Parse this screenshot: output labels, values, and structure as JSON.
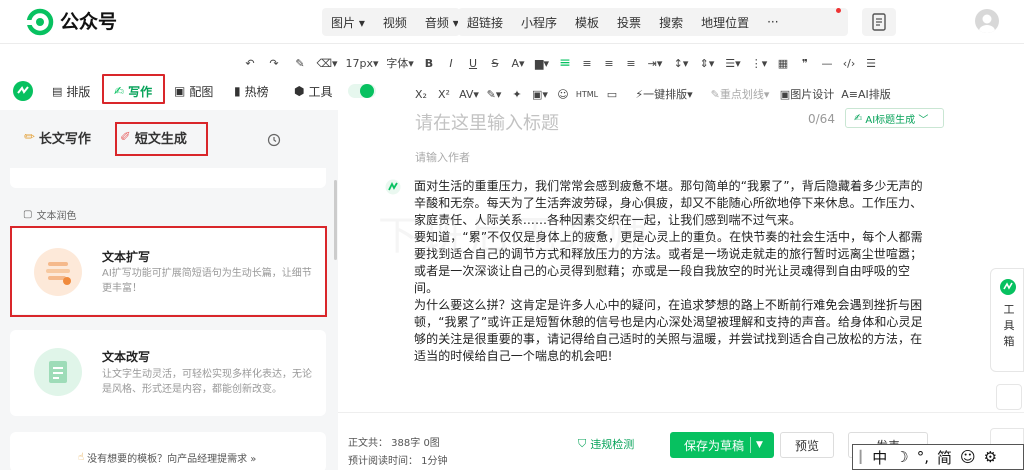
{
  "brand": {
    "name": "公众号",
    "accent": "#07c160"
  },
  "top_menu": {
    "pill1": [
      "图片",
      "视频",
      "音频"
    ],
    "pill2": [
      "超链接",
      "小程序",
      "模板",
      "投票",
      "搜索",
      "地理位置",
      "···"
    ]
  },
  "format_toolbar": {
    "font_size": "17px",
    "font": "字体",
    "row2": {
      "one_click": "一键排版",
      "highlight": "重点划线",
      "image_design": "图片设计",
      "ai_layout": "AI排版"
    }
  },
  "left_tools": {
    "items": [
      {
        "label": "排版"
      },
      {
        "label": "写作",
        "active": true
      },
      {
        "label": "配图"
      },
      {
        "label": "热榜"
      },
      {
        "label": "工具"
      }
    ]
  },
  "panel": {
    "tab_long": "长文写作",
    "tab_short": "短文生成",
    "section": "文本润色",
    "cards": [
      {
        "title": "文本扩写",
        "desc": "AI扩写功能可扩展简短语句为生动长篇，让细节更丰富！"
      },
      {
        "title": "文本改写",
        "desc": "让文字生动灵活，可轻松实现多样化表达，无论是风格、形式还是内容，都能创新改变。"
      }
    ],
    "hint": "没有想要的模板？向产品经理提需求 »"
  },
  "editor": {
    "title_placeholder": "请在这里输入标题",
    "title_count": "0/64",
    "ai_title": "AI标题生成 ﹀",
    "author_placeholder": "请输入作者",
    "paragraphs": [
      "面对生活的重重压力，我们常常会感到疲惫不堪。那句简单的“我累了”，背后隐藏着多少无声的辛酸和无奈。每天为了生活奔波劳碌，身心俱疲，却又不能随心所欲地停下来休息。工作压力、家庭责任、人际关系……各种因素交织在一起，让我们感到喘不过气来。",
      "要知道，“累”不仅仅是身体上的疲惫，更是心灵上的重负。在快节奏的社会生活中，每个人都需要找到适合自己的调节方式和释放压力的方法。或者是一场说走就走的旅行暂时远离尘世喧嚣；或者是一次深谈让自己的心灵得到慰藉；亦或是一段自我放空的时光让灵魂得到自由呼吸的空间。",
      "为什么要这么拼？这肯定是许多人心中的疑问，在追求梦想的路上不断前行难免会遇到挫折与困顿，“我累了”或许正是短暂休憩的信号也是内心深处渴望被理解和支持的声音。给身体和心灵足够的关注是很重要的事，请记得给自己适时的关照与温暖，并尝试找到适合自己放松的方法，在适当的时候给自己一个喘息的机会吧!"
    ],
    "watermark": "下班后无米师"
  },
  "bottom": {
    "text_count": "正文共：   388字 0图",
    "read_time": "预计阅读时间：   1分钟",
    "check": "违规检测",
    "save": "保存为草稿",
    "preview": "预览",
    "publish": "发表"
  },
  "ime": [
    "中",
    "☽",
    "°,",
    "简",
    "☺",
    "⚙"
  ],
  "toolbox_label": "工具箱"
}
